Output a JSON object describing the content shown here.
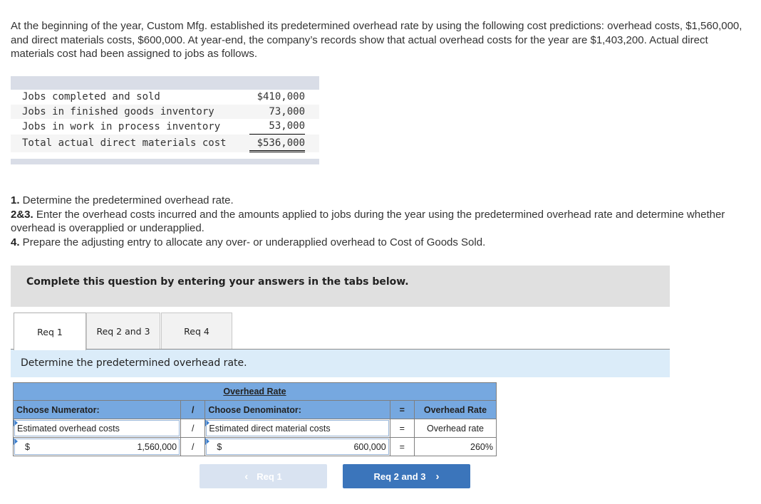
{
  "intro": {
    "text": "At the beginning of the year, Custom Mfg. established its predetermined overhead rate by using the following cost predictions: overhead costs, $1,560,000, and direct materials costs, $600,000. At year-end, the company’s records show that actual overhead costs for the year are $1,403,200. Actual direct materials cost had been assigned to jobs as follows."
  },
  "cost_table": {
    "rows": [
      {
        "label": "Jobs completed and sold",
        "amount": "$410,000"
      },
      {
        "label": "Jobs in finished goods inventory",
        "amount": "73,000"
      },
      {
        "label": "Jobs in work in process inventory",
        "amount": "53,000"
      },
      {
        "label": "Total actual direct materials cost",
        "amount": "$536,000"
      }
    ]
  },
  "requirements": [
    {
      "num": "1.",
      "text": " Determine the predetermined overhead rate."
    },
    {
      "num": "2&3.",
      "text": " Enter the overhead costs incurred and the amounts applied to jobs during the year using the predetermined overhead rate and determine whether overhead is overapplied or underapplied."
    },
    {
      "num": "4.",
      "text": " Prepare the adjusting entry to allocate any over- or underapplied overhead to Cost of Goods Sold."
    }
  ],
  "complete_banner": "Complete this question by entering your answers in the tabs below.",
  "tabs": [
    {
      "label": "Req 1",
      "active": true
    },
    {
      "label": "Req 2 and 3",
      "active": false
    },
    {
      "label": "Req 4",
      "active": false
    }
  ],
  "instruction": "Determine the predetermined overhead rate.",
  "rate_table": {
    "title": "Overhead Rate",
    "header": {
      "numerator": "Choose Numerator:",
      "div": "/",
      "denominator": "Choose Denominator:",
      "eq": "=",
      "result": "Overhead Rate"
    },
    "label_row": {
      "numerator": "Estimated overhead costs",
      "div": "/",
      "denominator": "Estimated direct material costs",
      "eq": "=",
      "result": "Overhead rate"
    },
    "value_row": {
      "numerator_currency": "$",
      "numerator": "1,560,000",
      "div": "/",
      "denominator_currency": "$",
      "denominator": "600,000",
      "eq": "=",
      "result": "260%"
    }
  },
  "nav": {
    "prev_label": "Req 1",
    "next_label": "Req 2 and 3",
    "prev_icon": "‹",
    "next_icon": "›"
  }
}
